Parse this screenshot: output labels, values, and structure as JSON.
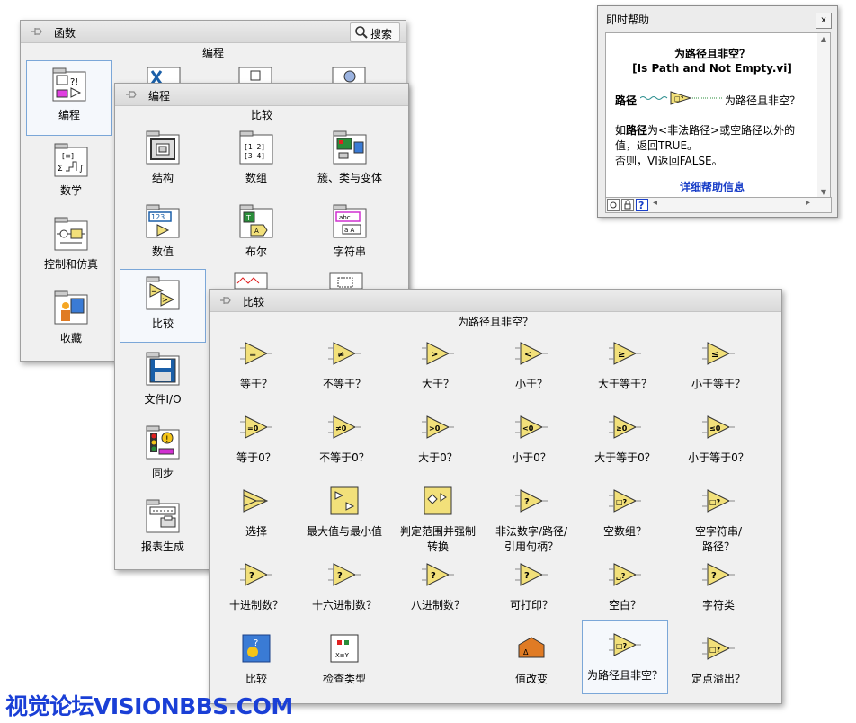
{
  "p1": {
    "title": "函数",
    "search_label": "搜索",
    "crumb": "编程",
    "items": [
      "编程",
      "数学",
      "控制和仿真",
      "收藏"
    ]
  },
  "p2": {
    "title": "编程",
    "crumb": "比较",
    "items": [
      "结构",
      "数组",
      "簇、类与变体",
      "数值",
      "布尔",
      "字符串",
      "比较",
      "文件I/O",
      "同步",
      "报表生成"
    ]
  },
  "p3": {
    "title": "比较",
    "crumb": "为路径且非空？",
    "items": [
      "等于？",
      "不等于？",
      "大于？",
      "小于？",
      "大于等于？",
      "小于等于？",
      "等于0？",
      "不等于0？",
      "大于0？",
      "小于0？",
      "大于等于0？",
      "小于等于0？",
      "选择",
      "最大值与最小值",
      "判定范围并强制\n转换",
      "非法数字/路径/\n引用句柄？",
      "空数组？",
      "空字符串/\n路径？",
      "十进制数？",
      "十六进制数？",
      "八进制数？",
      "可打印？",
      "空白？",
      "字符类",
      "比较",
      "检查类型",
      "值改变",
      "为路径且非空？",
      "定点溢出？"
    ]
  },
  "help": {
    "title": "即时帮助",
    "close": "x",
    "heading": "为路径且非空？",
    "vi_name": "[Is Path and Not Empty.vi]",
    "input_label": "路径",
    "output_label": "为路径且非空？",
    "desc_line1_pre": "如",
    "desc_line1_bold": "路径",
    "desc_line1_post": "为<非法路径>或空路径以外的",
    "desc_line2": "值，返回TRUE。",
    "desc_line3": "否则，VI返回FALSE。",
    "link": "详细帮助信息",
    "scroll_up": "▲",
    "scroll_down": "▼",
    "scroll_left": "◂",
    "scroll_right": "▸"
  },
  "watermark": "视觉论坛VISIONBBS.COM"
}
